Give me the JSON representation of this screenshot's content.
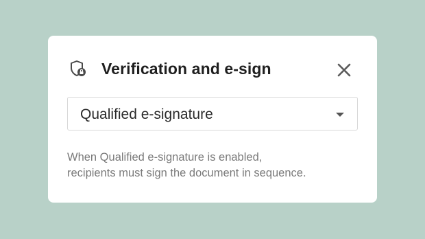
{
  "dialog": {
    "title": "Verification and e-sign",
    "header_icon": "shield-lock-icon",
    "close_icon": "close-icon",
    "select": {
      "value": "Qualified e-signature",
      "caret_icon": "caret-down-icon"
    },
    "description_lines": [
      "When Qualified e-signature is enabled,",
      "recipients must sign the document in sequence."
    ]
  },
  "colors": {
    "background": "#b8d1c8",
    "card": "#ffffff",
    "title_text": "#1f1f1f",
    "muted_text": "#7a7a7a",
    "icon": "#4a4a4a"
  }
}
